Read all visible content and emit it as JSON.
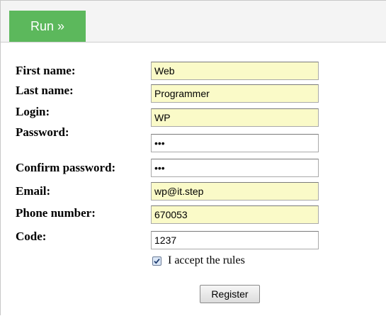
{
  "toolbar": {
    "run_label": "Run »",
    "run_color": "#5cb85c"
  },
  "form": {
    "fields": [
      {
        "label": "First name:",
        "value": "Web",
        "autofilled": true
      },
      {
        "label": "Last name:",
        "value": "Programmer",
        "autofilled": true
      },
      {
        "label": "Login:",
        "value": "WP",
        "autofilled": true
      },
      {
        "label": "Password:",
        "value": "•••",
        "autofilled": false
      },
      {
        "label": "Confirm password:",
        "value": "•••",
        "autofilled": false
      },
      {
        "label": "Email:",
        "value": "wp@it.step",
        "autofilled": true
      },
      {
        "label": "Phone number:",
        "value": "670053",
        "autofilled": true
      },
      {
        "label": "Code:",
        "value": "1237",
        "autofilled": false
      }
    ],
    "accept_rules_label": "I accept the rules",
    "accept_rules_checked": true,
    "register_label": "Register",
    "autofill_color": "#fafac8"
  },
  "icons": {
    "checkmark": "checkmark-icon"
  }
}
